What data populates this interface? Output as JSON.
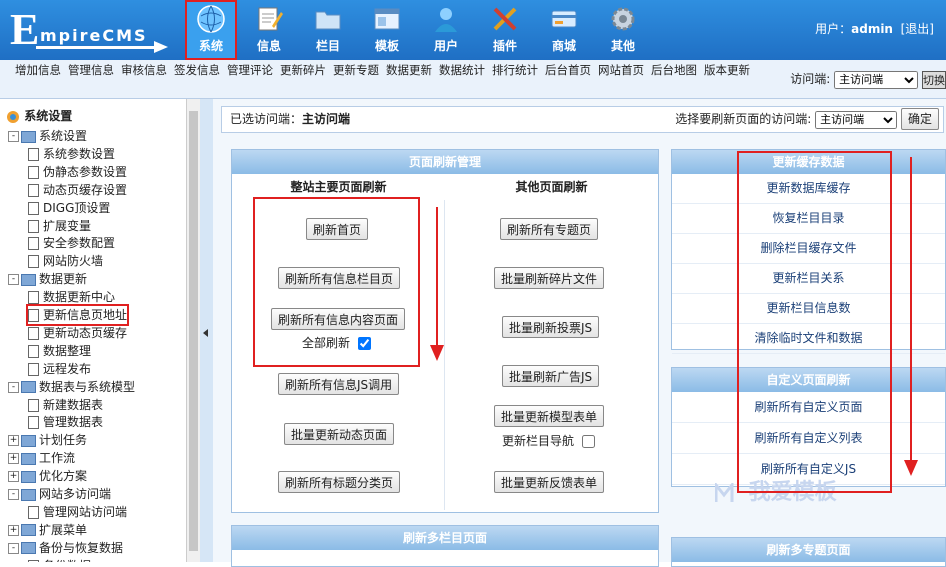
{
  "header": {
    "logo_initial": "E",
    "logo_rest": "mpireCMS",
    "nav": [
      {
        "label": "系统",
        "icon": "globe-icon"
      },
      {
        "label": "信息",
        "icon": "notepad-icon"
      },
      {
        "label": "栏目",
        "icon": "folder-icon"
      },
      {
        "label": "模板",
        "icon": "window-icon"
      },
      {
        "label": "用户",
        "icon": "user-icon"
      },
      {
        "label": "插件",
        "icon": "tools-icon"
      },
      {
        "label": "商城",
        "icon": "card-icon"
      },
      {
        "label": "其他",
        "icon": "gear-icon"
      }
    ],
    "user_prefix": "用户：",
    "username": "admin",
    "logout": "[退出]"
  },
  "toolbar": {
    "items": [
      "增加信息",
      "管理信息",
      "审核信息",
      "签发信息",
      "管理评论",
      "更新碎片",
      "更新专题",
      "数据更新",
      "数据统计",
      "排行统计",
      "后台首页",
      "网站首页",
      "后台地图",
      "版本更新"
    ],
    "access_label": "访问端:",
    "access_value": "主访问端",
    "switch_label": "切换"
  },
  "tree": {
    "root": "系统设置",
    "rows": [
      {
        "label": "系统设置",
        "type": "folder",
        "pm": "-"
      },
      {
        "label": "系统参数设置",
        "type": "doc"
      },
      {
        "label": "伪静态参数设置",
        "type": "doc"
      },
      {
        "label": "动态页缓存设置",
        "type": "doc"
      },
      {
        "label": "DIGG顶设置",
        "type": "doc"
      },
      {
        "label": "扩展变量",
        "type": "doc"
      },
      {
        "label": "安全参数配置",
        "type": "doc"
      },
      {
        "label": "网站防火墙",
        "type": "doc"
      },
      {
        "label": "数据更新",
        "type": "folder",
        "pm": "-"
      },
      {
        "label": "数据更新中心",
        "type": "doc"
      },
      {
        "label": "更新信息页地址",
        "type": "doc"
      },
      {
        "label": "更新动态页缓存",
        "type": "doc"
      },
      {
        "label": "数据整理",
        "type": "doc"
      },
      {
        "label": "远程发布",
        "type": "doc"
      },
      {
        "label": "数据表与系统模型",
        "type": "folder",
        "pm": "-"
      },
      {
        "label": "新建数据表",
        "type": "doc"
      },
      {
        "label": "管理数据表",
        "type": "doc"
      },
      {
        "label": "计划任务",
        "type": "folder",
        "pm": "+"
      },
      {
        "label": "工作流",
        "type": "folder",
        "pm": "+"
      },
      {
        "label": "优化方案",
        "type": "folder",
        "pm": "+"
      },
      {
        "label": "网站多访问端",
        "type": "folder",
        "pm": "-"
      },
      {
        "label": "管理网站访问端",
        "type": "doc"
      },
      {
        "label": "扩展菜单",
        "type": "folder",
        "pm": "+"
      },
      {
        "label": "备份与恢复数据",
        "type": "folder",
        "pm": "-"
      },
      {
        "label": "备份数据",
        "type": "doc"
      }
    ]
  },
  "select_bar": {
    "selected_label": "已选访问端：",
    "selected_value": "主访问端",
    "choose_label": "选择要刷新页面的访问端:",
    "choose_value": "主访问端",
    "confirm": "确定"
  },
  "refresh_panel": {
    "title": "页面刷新管理",
    "col1_title": "整站主要页面刷新",
    "col2_title": "其他页面刷新",
    "col1_buttons": [
      "刷新首页",
      "刷新所有信息栏目页",
      "刷新所有信息内容页面"
    ],
    "all_refresh_label": "全部刷新",
    "col1_lower": [
      "刷新所有信息JS调用",
      "批量更新动态页面",
      "刷新所有标题分类页"
    ],
    "col2_buttons": [
      "刷新所有专题页",
      "批量刷新碎片文件",
      "批量刷新投票JS",
      "批量刷新广告JS",
      "批量更新模型表单"
    ],
    "update_nav_label": "更新栏目导航",
    "col2_last": "批量更新反馈表单"
  },
  "cache_panel": {
    "title": "更新缓存数据",
    "items": [
      "更新数据库缓存",
      "恢复栏目目录",
      "删除栏目缓存文件",
      "更新栏目关系",
      "更新栏目信息数",
      "清除临时文件和数据"
    ]
  },
  "custom_panel": {
    "title": "自定义页面刷新",
    "items": [
      "刷新所有自定义页面",
      "刷新所有自定义列表",
      "刷新所有自定义JS"
    ]
  },
  "bottom": {
    "multi_column": "刷新多栏目页面",
    "multi_topic": "刷新多专题页面"
  },
  "watermark": "我爱模板",
  "colors": {
    "header": "#1f6fc4",
    "panel_header": "#8bbbe6",
    "annotation": "#e02020",
    "link": "#1a3f77"
  }
}
